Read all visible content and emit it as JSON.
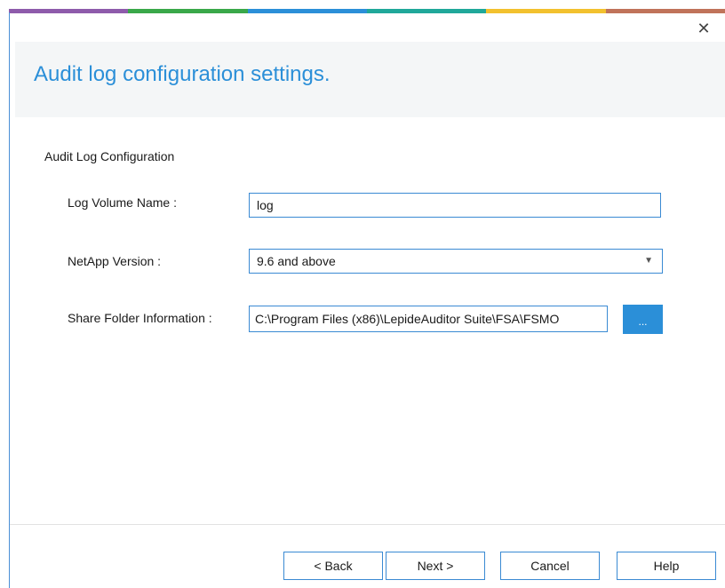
{
  "window": {
    "close_glyph": "✕",
    "accent_strip_colors": [
      "#8e5bab",
      "#3aa84a",
      "#2b8fd8",
      "#20a89a",
      "#f2c12e",
      "#c0735a"
    ]
  },
  "header": {
    "title": "Audit log configuration settings."
  },
  "section": {
    "title": "Audit Log Configuration"
  },
  "fields": {
    "log_volume": {
      "label": "Log Volume Name :",
      "value": "log"
    },
    "netapp_version": {
      "label": "NetApp Version :",
      "selected": "9.6 and above"
    },
    "share_folder": {
      "label": "Share Folder Information :",
      "value": "C:\\Program Files (x86)\\LepideAuditor Suite\\FSA\\FSMO",
      "browse_label": "..."
    }
  },
  "footer": {
    "back_label": "< Back",
    "next_label": "Next >",
    "cancel_label": "Cancel",
    "help_label": "Help"
  },
  "icons": {
    "close": "close-icon",
    "dropdown": "chevron-down-icon"
  },
  "colors": {
    "accent": "#2b8fd8",
    "header_bg": "#f4f6f7",
    "border": "#3a8ad3"
  }
}
